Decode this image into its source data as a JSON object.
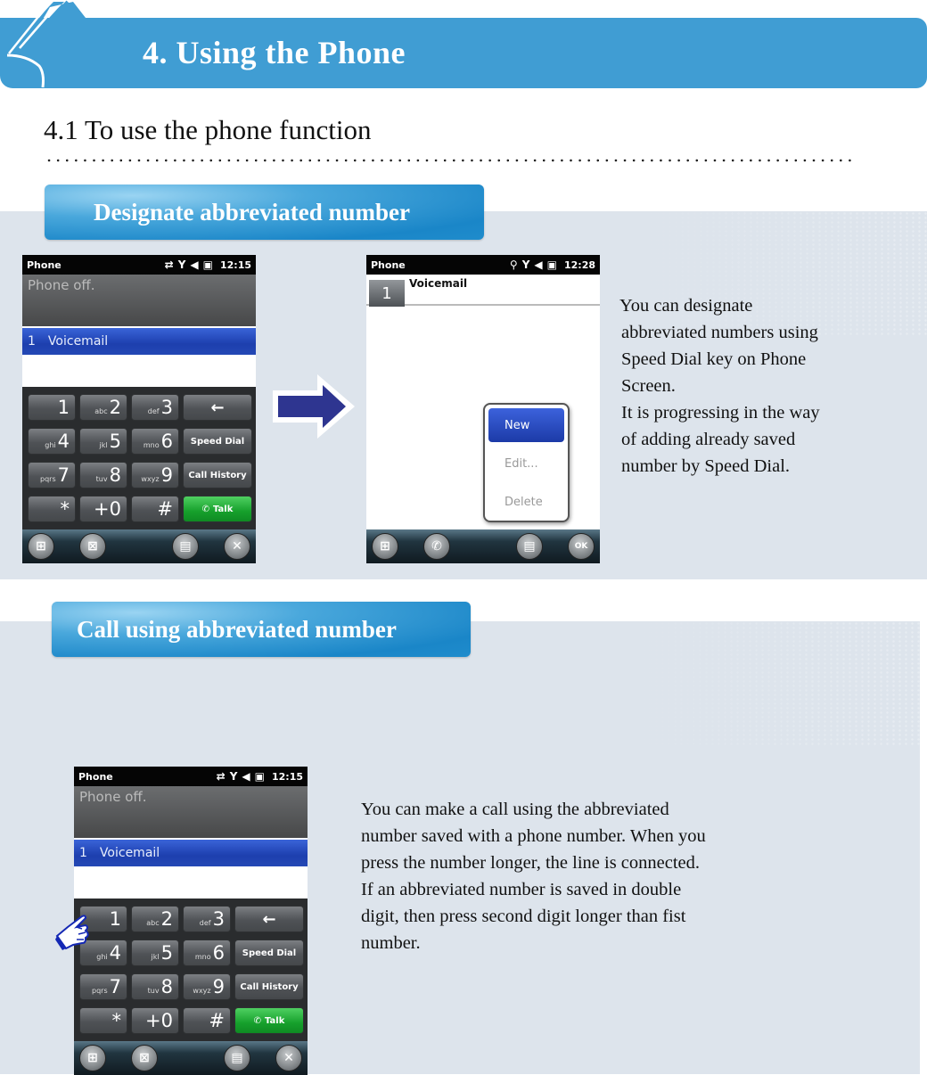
{
  "header": {
    "title": "4. Using the Phone",
    "color": "#409dd3"
  },
  "section": {
    "title": "4.1 To use the phone function"
  },
  "designate": {
    "tag_label": "Designate abbreviated number",
    "description_lines": [
      "You can designate",
      "abbreviated numbers using",
      "Speed Dial key on Phone",
      "Screen.",
      "It is progressing in the way",
      "of adding already saved",
      "number by Speed Dial."
    ],
    "screen_before": {
      "app_name": "Phone",
      "time": "12:15",
      "status_text": "Phone off.",
      "selected_entry": {
        "number": "1",
        "name": "Voicemail"
      },
      "keys": [
        {
          "letters": "",
          "digit": "1"
        },
        {
          "letters": "abc",
          "digit": "2"
        },
        {
          "letters": "def",
          "digit": "3"
        },
        {
          "label": "←"
        },
        {
          "letters": "ghi",
          "digit": "4"
        },
        {
          "letters": "jkl",
          "digit": "5"
        },
        {
          "letters": "mno",
          "digit": "6"
        },
        {
          "label": "Speed Dial"
        },
        {
          "letters": "pqrs",
          "digit": "7"
        },
        {
          "letters": "tuv",
          "digit": "8"
        },
        {
          "letters": "wxyz",
          "digit": "9"
        },
        {
          "label": "Call History"
        },
        {
          "letters": "",
          "digit": "*"
        },
        {
          "letters": "",
          "digit": "+0"
        },
        {
          "letters": "",
          "digit": "#"
        },
        {
          "label": "Talk"
        }
      ]
    },
    "screen_after": {
      "app_name": "Phone",
      "time": "12:28",
      "speed_dial_entry": {
        "number": "1",
        "name": "Voicemail"
      },
      "menu_items": [
        "New",
        "Edit...",
        "Delete"
      ],
      "active_menu_item": "New",
      "ok_label": "OK"
    }
  },
  "call": {
    "tag_label": "Call  using abbreviated number",
    "description_lines": [
      "You can make a call using the abbreviated",
      "number saved with a phone number. When you",
      "press the number longer, the line is connected.",
      "If an abbreviated number is saved in double",
      "digit, then press second digit longer than fist",
      "number."
    ],
    "screen": {
      "app_name": "Phone",
      "time": "12:15",
      "status_text": "Phone off.",
      "selected_entry": {
        "number": "1",
        "name": "Voicemail"
      }
    }
  },
  "icons": {
    "arrow": "right-arrow-icon",
    "pointer": "pointing-hand-icon"
  }
}
